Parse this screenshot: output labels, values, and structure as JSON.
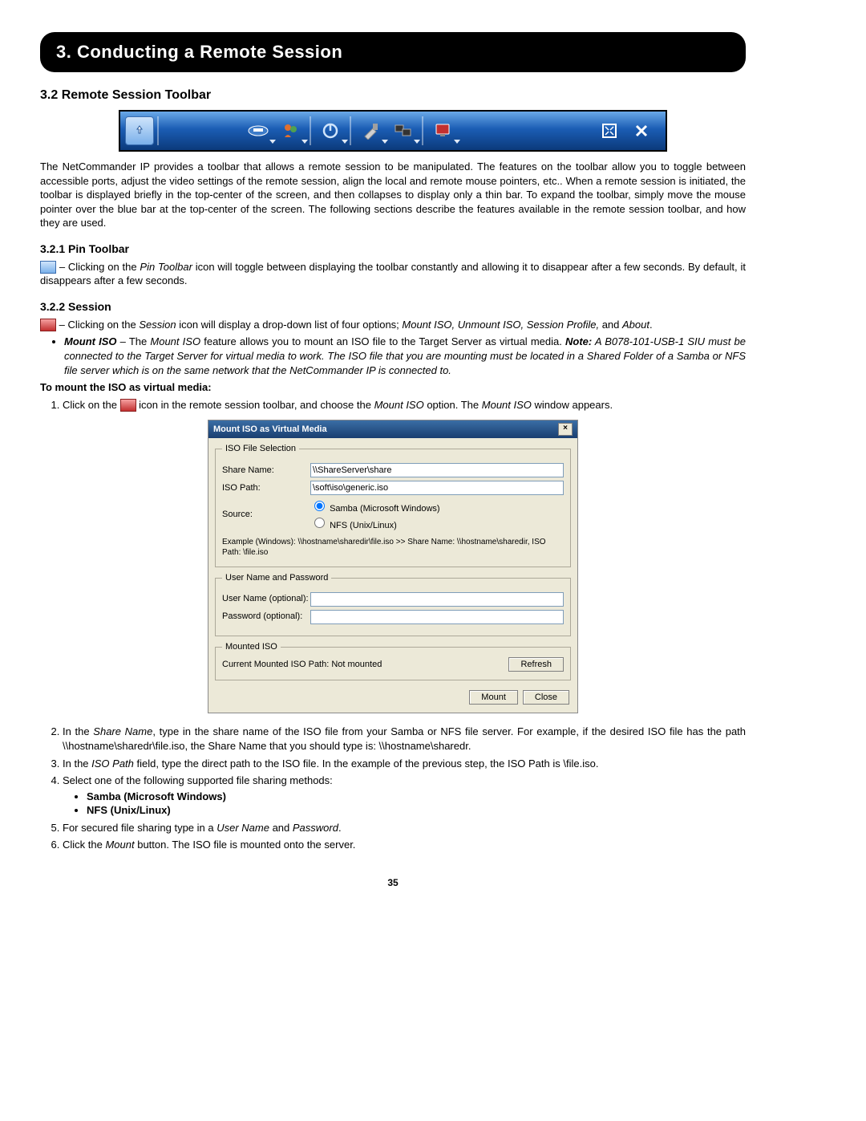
{
  "chapter": "3. Conducting a Remote Session",
  "section": "3.2 Remote Session Toolbar",
  "intro": "The NetCommander IP provides a toolbar that allows a remote session to be manipulated. The features on the toolbar allow you to toggle between accessible ports, adjust the video settings of the remote session, align the local and remote mouse pointers, etc.. When a remote session is initiated, the toolbar is displayed briefly in the top-center of the screen, and then collapses to display only a thin bar. To expand the toolbar, simply move the mouse pointer over the blue bar at the top-center of the screen. The following sections describe the features available in the remote session toolbar, and how they are used.",
  "sub1": {
    "title": "3.2.1 Pin Toolbar",
    "pre": " – Clicking on the ",
    "iconlabel": "Pin Toolbar",
    "post": " icon will toggle between displaying the toolbar constantly and allowing it to disappear after a few seconds. By default, it disappears after a few seconds."
  },
  "sub2": {
    "title": "3.2.2 Session",
    "pre": " – Clicking on the ",
    "iconlabel": "Session",
    "mid": " icon will display a drop-down list of four options; ",
    "opts": "Mount ISO, Unmount ISO, Session Profile,",
    "and": " and ",
    "about": "About"
  },
  "mountiso": {
    "bullet_bold": "Mount ISO",
    "bullet_text1": " – The ",
    "bullet_italic1": "Mount ISO",
    "bullet_text2": " feature allows you to mount an ISO file to the Target Server as virtual media. ",
    "note_bold": "Note:",
    "note_text": " A B078-101-USB-1 SIU must be connected to the Target Server for virtual media to work. The ISO file that you are mounting must be located in a Shared Folder of a Samba or NFS file server which is on the same network that the NetCommander IP is connected to."
  },
  "mount_heading": "To mount the ISO as virtual media:",
  "step1": {
    "a": "Click on the ",
    "b": " icon in the remote session toolbar, and choose the ",
    "c": "Mount ISO",
    "d": " option. The ",
    "e": "Mount ISO",
    "f": " window appears."
  },
  "dialog": {
    "title": "Mount ISO as Virtual Media",
    "fs1": "ISO File Selection",
    "share_label": "Share Name:",
    "share_value": "\\\\ShareServer\\share",
    "iso_label": "ISO Path:",
    "iso_value": "\\soft\\iso\\generic.iso",
    "source_label": "Source:",
    "radio1": "Samba (Microsoft Windows)",
    "radio2": "NFS (Unix/Linux)",
    "example": "Example (Windows):  \\\\hostname\\sharedir\\file.iso  >>  Share Name:  \\\\hostname\\sharedir, ISO Path: \\file.iso",
    "fs2": "User Name and Password",
    "user_label": "User Name (optional):",
    "pass_label": "Password (optional):",
    "fs3": "Mounted ISO",
    "mounted_text": "Current Mounted ISO Path: Not mounted",
    "refresh": "Refresh",
    "mount": "Mount",
    "close": "Close"
  },
  "step2": {
    "a": "In the ",
    "b": "Share Name",
    "c": ", type in the share name of the ISO file from your Samba or NFS file server. For example, if the desired ISO file has the path \\\\hostname\\sharedr\\file.iso, the Share Name that you should type is: \\\\hostname\\sharedr."
  },
  "step3": {
    "a": "In the ",
    "b": "ISO Path",
    "c": " field, type the direct path to the ISO file. In the example of the previous step, the ISO Path is \\file.iso."
  },
  "step4": "Select one of the following supported file sharing methods:",
  "step4_b1": "Samba (Microsoft Windows)",
  "step4_b2": "NFS (Unix/Linux)",
  "step5": {
    "a": "For secured file sharing type in a ",
    "b": "User Name",
    "c": " and ",
    "d": "Password",
    "e": "."
  },
  "step6": {
    "a": "Click the ",
    "b": "Mount",
    "c": " button. The ISO file is mounted onto the server."
  },
  "page_number": "35"
}
